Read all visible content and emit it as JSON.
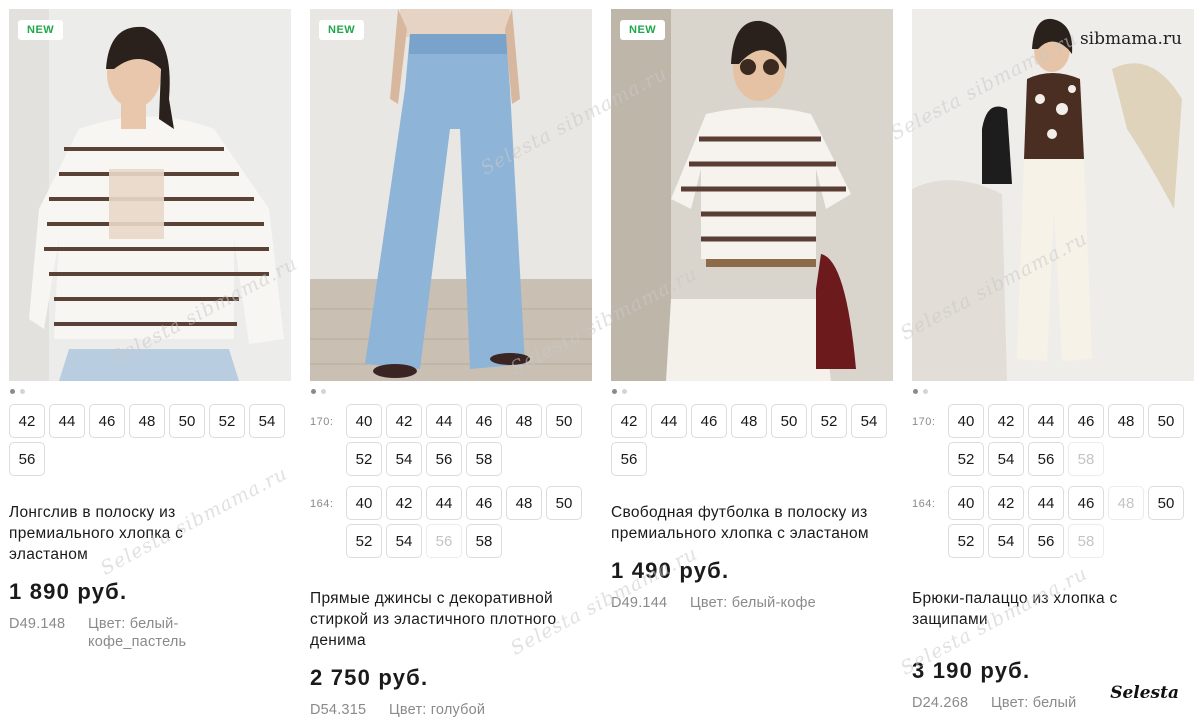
{
  "badge_new": "NEW",
  "watermarks": {
    "site": "sibmama.ru",
    "brand": "Selesta",
    "overlay": "Selesta sibmama.ru"
  },
  "products": [
    {
      "is_new": true,
      "image": "striped-longsleeve-photo",
      "slide_dots": 2,
      "size_groups": [
        {
          "label": "",
          "sizes": [
            {
              "v": "42",
              "ok": true
            },
            {
              "v": "44",
              "ok": true
            },
            {
              "v": "46",
              "ok": true
            },
            {
              "v": "48",
              "ok": true
            },
            {
              "v": "50",
              "ok": true
            },
            {
              "v": "52",
              "ok": true
            },
            {
              "v": "54",
              "ok": true
            },
            {
              "v": "56",
              "ok": true
            }
          ]
        }
      ],
      "title": "Лонгслив в полоску из премиального хлопка с эластаном",
      "price": "1 890 руб.",
      "code": "D49.148",
      "color": "Цвет: белый-кофе_пастель"
    },
    {
      "is_new": true,
      "image": "wide-jeans-photo",
      "slide_dots": 2,
      "size_groups": [
        {
          "label": "170:",
          "sizes": [
            {
              "v": "40",
              "ok": true
            },
            {
              "v": "42",
              "ok": true
            },
            {
              "v": "44",
              "ok": true
            },
            {
              "v": "46",
              "ok": true
            },
            {
              "v": "48",
              "ok": true
            },
            {
              "v": "50",
              "ok": true
            },
            {
              "v": "52",
              "ok": true
            },
            {
              "v": "54",
              "ok": true
            },
            {
              "v": "56",
              "ok": true
            },
            {
              "v": "58",
              "ok": true
            }
          ]
        },
        {
          "label": "164:",
          "sizes": [
            {
              "v": "40",
              "ok": true
            },
            {
              "v": "42",
              "ok": true
            },
            {
              "v": "44",
              "ok": true
            },
            {
              "v": "46",
              "ok": true
            },
            {
              "v": "48",
              "ok": true
            },
            {
              "v": "50",
              "ok": true
            },
            {
              "v": "52",
              "ok": true
            },
            {
              "v": "54",
              "ok": true
            },
            {
              "v": "56",
              "ok": false
            },
            {
              "v": "58",
              "ok": true
            }
          ]
        }
      ],
      "title": "Прямые джинсы с декоративной стиркой из эластичного плотного денима",
      "price": "2 750 руб.",
      "code": "D54.315",
      "color": "Цвет: голубой"
    },
    {
      "is_new": true,
      "image": "striped-tshirt-photo",
      "slide_dots": 2,
      "size_groups": [
        {
          "label": "",
          "sizes": [
            {
              "v": "42",
              "ok": true
            },
            {
              "v": "44",
              "ok": true
            },
            {
              "v": "46",
              "ok": true
            },
            {
              "v": "48",
              "ok": true
            },
            {
              "v": "50",
              "ok": true
            },
            {
              "v": "52",
              "ok": true
            },
            {
              "v": "54",
              "ok": true
            },
            {
              "v": "56",
              "ok": true
            }
          ]
        }
      ],
      "title": "Свободная футболка в полоску из премиального хлопка с эластаном",
      "price": "1 490 руб.",
      "code": "D49.144",
      "color": "Цвет: белый-кофе"
    },
    {
      "is_new": false,
      "image": "palazzo-trousers-photo",
      "slide_dots": 2,
      "size_groups": [
        {
          "label": "170:",
          "sizes": [
            {
              "v": "40",
              "ok": true
            },
            {
              "v": "42",
              "ok": true
            },
            {
              "v": "44",
              "ok": true
            },
            {
              "v": "46",
              "ok": true
            },
            {
              "v": "48",
              "ok": true
            },
            {
              "v": "50",
              "ok": true
            },
            {
              "v": "52",
              "ok": true
            },
            {
              "v": "54",
              "ok": true
            },
            {
              "v": "56",
              "ok": true
            },
            {
              "v": "58",
              "ok": false
            }
          ]
        },
        {
          "label": "164:",
          "sizes": [
            {
              "v": "40",
              "ok": true
            },
            {
              "v": "42",
              "ok": true
            },
            {
              "v": "44",
              "ok": true
            },
            {
              "v": "46",
              "ok": true
            },
            {
              "v": "48",
              "ok": false
            },
            {
              "v": "50",
              "ok": true
            },
            {
              "v": "52",
              "ok": true
            },
            {
              "v": "54",
              "ok": true
            },
            {
              "v": "56",
              "ok": true
            },
            {
              "v": "58",
              "ok": false
            }
          ]
        }
      ],
      "title": "Брюки-палаццо из хлопка с защипами",
      "price": "3 190 руб.",
      "code": "D24.268",
      "color": "Цвет: белый"
    }
  ]
}
